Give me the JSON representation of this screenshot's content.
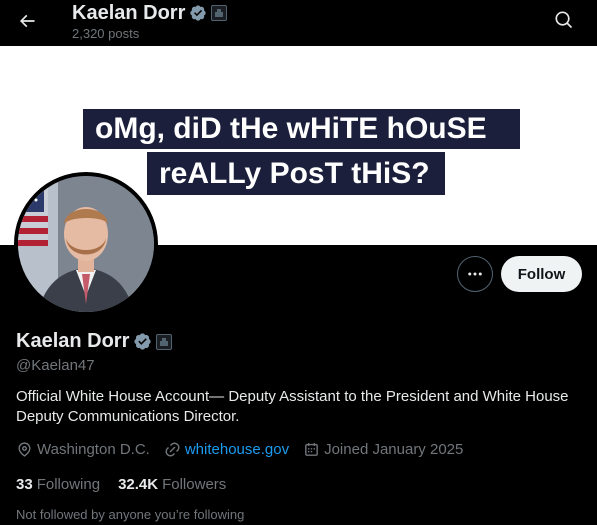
{
  "header": {
    "name": "Kaelan Dorr",
    "posts_count": "2,320 posts",
    "back_icon": "arrow-left-icon",
    "search_icon": "search-icon"
  },
  "banner": {
    "line1": "oMg, diD tHe wHiTE hOuSE",
    "line2": "reALLy PosT tHiS?"
  },
  "profile": {
    "name": "Kaelan Dorr",
    "handle": "@Kaelan47",
    "bio": "Official White House Account— Deputy Assistant to the President and White House Deputy Communications Director.",
    "location": "Washington D.C.",
    "website": "whitehouse.gov",
    "joined": "Joined January 2025",
    "following_count": "33",
    "following_label": "Following",
    "followers_count": "32.4K",
    "followers_label": "Followers",
    "followed_note": "Not followed by anyone you’re following"
  },
  "actions": {
    "follow_label": "Follow"
  },
  "colors": {
    "accent": "#1d9bf0",
    "verified": "#829aab",
    "background": "#000000",
    "banner_bar": "#1b1f3b"
  }
}
